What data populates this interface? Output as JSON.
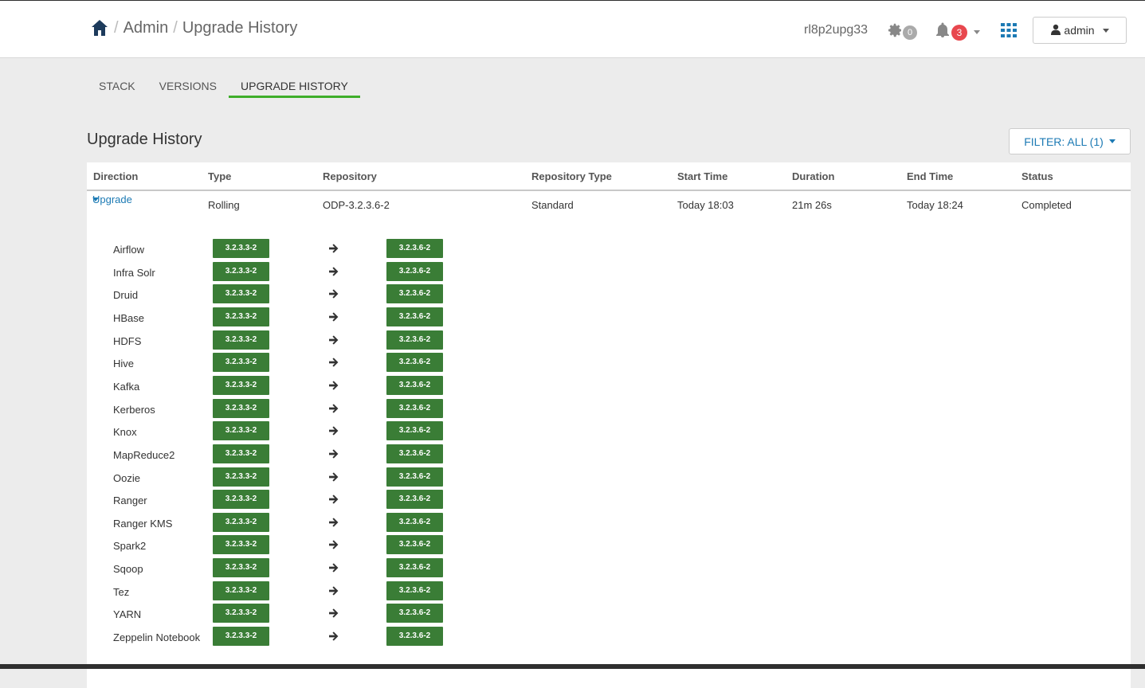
{
  "header": {
    "breadcrumb": [
      "Admin",
      "Upgrade History"
    ],
    "cluster_name": "rl8p2upg33",
    "ops_count": "0",
    "alerts_count": "3",
    "user_label": "admin"
  },
  "tabs": [
    {
      "label": "STACK",
      "active": false
    },
    {
      "label": "VERSIONS",
      "active": false
    },
    {
      "label": "UPGRADE HISTORY",
      "active": true
    }
  ],
  "page_title": "Upgrade History",
  "filter_label": "FILTER: ALL (1)",
  "table": {
    "headers": [
      "Direction",
      "Type",
      "Repository",
      "Repository Type",
      "Start Time",
      "Duration",
      "End Time",
      "Status"
    ],
    "row": {
      "direction": "Upgrade",
      "type": "Rolling",
      "repository": "ODP-3.2.3.6-2",
      "repository_type": "Standard",
      "start_time": "Today 18:03",
      "duration": "21m 26s",
      "end_time": "Today 18:24",
      "status": "Completed"
    }
  },
  "services": [
    {
      "name": "Airflow",
      "from": "3.2.3.3-2",
      "to": "3.2.3.6-2"
    },
    {
      "name": "Infra Solr",
      "from": "3.2.3.3-2",
      "to": "3.2.3.6-2"
    },
    {
      "name": "Druid",
      "from": "3.2.3.3-2",
      "to": "3.2.3.6-2"
    },
    {
      "name": "HBase",
      "from": "3.2.3.3-2",
      "to": "3.2.3.6-2"
    },
    {
      "name": "HDFS",
      "from": "3.2.3.3-2",
      "to": "3.2.3.6-2"
    },
    {
      "name": "Hive",
      "from": "3.2.3.3-2",
      "to": "3.2.3.6-2"
    },
    {
      "name": "Kafka",
      "from": "3.2.3.3-2",
      "to": "3.2.3.6-2"
    },
    {
      "name": "Kerberos",
      "from": "3.2.3.3-2",
      "to": "3.2.3.6-2"
    },
    {
      "name": "Knox",
      "from": "3.2.3.3-2",
      "to": "3.2.3.6-2"
    },
    {
      "name": "MapReduce2",
      "from": "3.2.3.3-2",
      "to": "3.2.3.6-2"
    },
    {
      "name": "Oozie",
      "from": "3.2.3.3-2",
      "to": "3.2.3.6-2"
    },
    {
      "name": "Ranger",
      "from": "3.2.3.3-2",
      "to": "3.2.3.6-2"
    },
    {
      "name": "Ranger KMS",
      "from": "3.2.3.3-2",
      "to": "3.2.3.6-2"
    },
    {
      "name": "Spark2",
      "from": "3.2.3.3-2",
      "to": "3.2.3.6-2"
    },
    {
      "name": "Sqoop",
      "from": "3.2.3.3-2",
      "to": "3.2.3.6-2"
    },
    {
      "name": "Tez",
      "from": "3.2.3.3-2",
      "to": "3.2.3.6-2"
    },
    {
      "name": "YARN",
      "from": "3.2.3.3-2",
      "to": "3.2.3.6-2"
    },
    {
      "name": "Zeppelin Notebook",
      "from": "3.2.3.3-2",
      "to": "3.2.3.6-2"
    }
  ],
  "colors": {
    "accent_blue": "#1c7ab4",
    "version_green": "#3a7d36",
    "active_tab": "#3fae2a",
    "alert_red": "#e8474e"
  }
}
